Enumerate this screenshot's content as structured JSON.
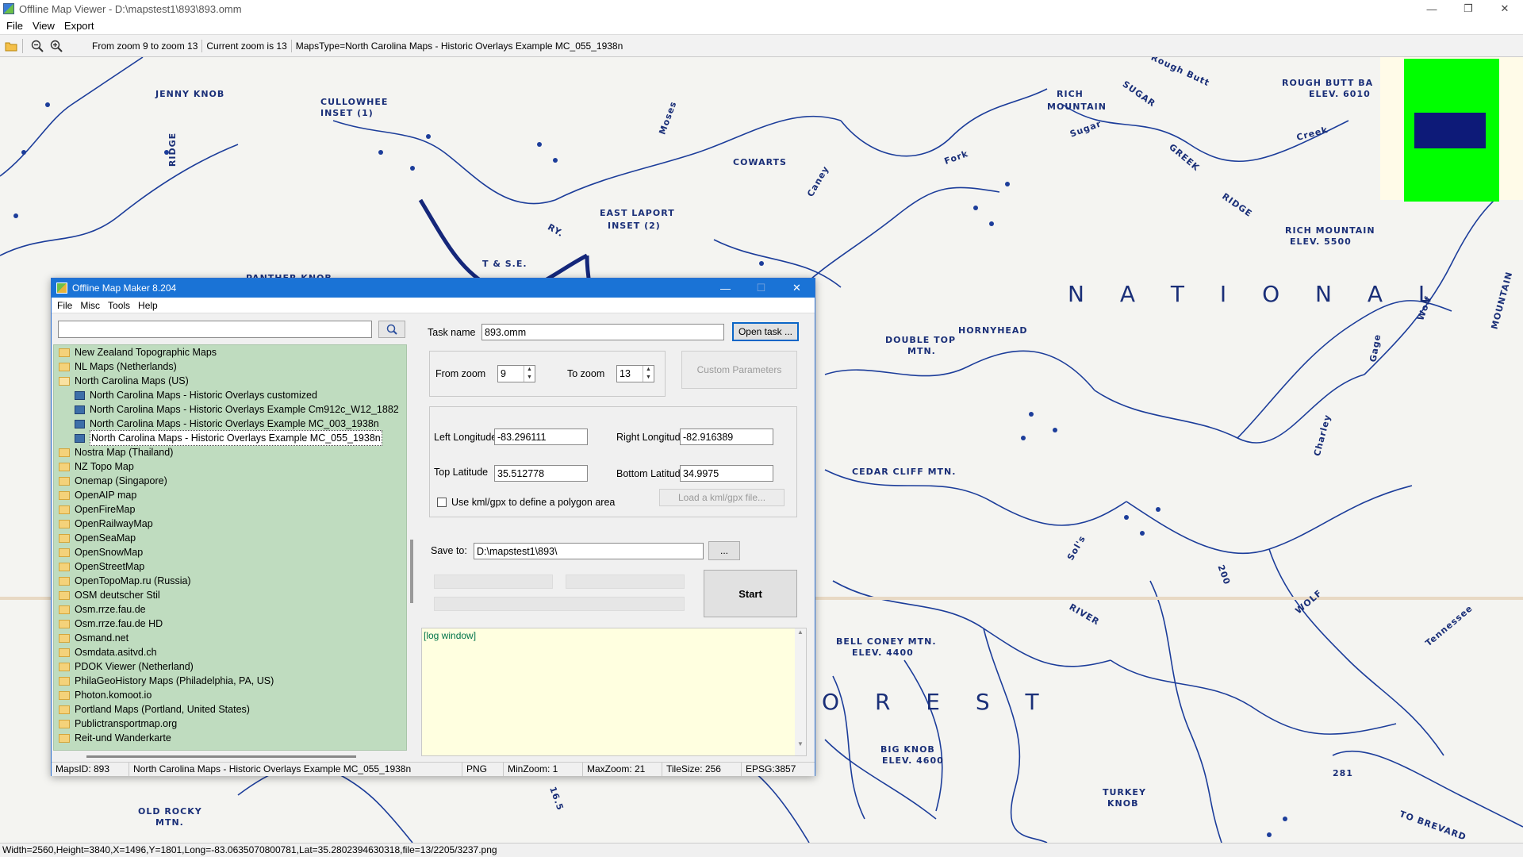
{
  "viewer": {
    "title": "Offline Map Viewer - D:\\mapstest1\\893\\893.omm",
    "window_buttons": [
      "—",
      "❐",
      "✕"
    ],
    "menu": [
      "File",
      "View",
      "Export"
    ],
    "toolbar_info": {
      "zoom_range": "From zoom 9 to zoom 13",
      "current_zoom": "Current zoom is 13",
      "maps_type": "MapsType=North Carolina Maps - Historic Overlays Example MC_055_1938n"
    },
    "status": "Width=2560,Height=3840,X=1496,Y=1801,Long=-83.0635070800781,Lat=35.2802394630318,file=13/2205/3237.png",
    "overview_colors": {
      "background": "#fffbe8",
      "fill": "#00ff00",
      "viewport": "#0d1a78"
    }
  },
  "map_labels": [
    "JENNY KNOB",
    "CULLOWHEE",
    "INSET (1)",
    "EAST LAPORT",
    "INSET (2)",
    "COWARTS",
    "Caney",
    "Fork",
    "RICH",
    "MOUNTAIN",
    "SUGAR",
    "Sugar",
    "Rough Butt",
    "ROUGH BUTT BA",
    "ELEV. 6010",
    "Creek",
    "GREEK",
    "RIDGE",
    "RICH MOUNTAIN",
    "ELEV. 5500",
    "N A T I O N A L",
    "HORNYHEAD",
    "DOUBLE TOP",
    "MTN.",
    "CEDAR CLIFF MTN.",
    "BELL CONEY MTN.",
    "ELEV. 4400",
    "O R E S T",
    "BIG KNOB",
    "ELEV. 4600",
    "TURKEY",
    "KNOB",
    "OLD ROCKY",
    "MTN.",
    "TO BREVARD",
    "Tennessee",
    "WOLF",
    "Charley",
    "Moses",
    "Sol's",
    "RIVER",
    "PANTHER KNOB",
    "T & S.E.",
    "RY.",
    "MOUNTAIN",
    "Wolf",
    "Gage",
    "RIDGE",
    "281",
    "200",
    "16.5"
  ],
  "maker": {
    "title": "Offline Map Maker 8.204",
    "window_buttons": [
      "—",
      "☐",
      "✕"
    ],
    "menu": [
      "File",
      "Misc",
      "Tools",
      "Help"
    ],
    "search": {
      "value": "",
      "placeholder": ""
    },
    "tree": [
      {
        "label": "New Zealand Topographic Maps",
        "level": 0
      },
      {
        "label": "NL Maps (Netherlands)",
        "level": 0
      },
      {
        "label": "North Carolina Maps (US)",
        "level": 0,
        "expanded": true
      },
      {
        "label": "North Carolina Maps - Historic Overlays customized",
        "level": 1
      },
      {
        "label": "North Carolina Maps - Historic Overlays Example Cm912c_W12_1882",
        "level": 1
      },
      {
        "label": "North Carolina Maps - Historic Overlays Example MC_003_1938n",
        "level": 1
      },
      {
        "label": "North Carolina Maps - Historic Overlays Example MC_055_1938n",
        "level": 1,
        "selected": true
      },
      {
        "label": "Nostra Map (Thailand)",
        "level": 0
      },
      {
        "label": "NZ Topo Map",
        "level": 0
      },
      {
        "label": "Onemap (Singapore)",
        "level": 0
      },
      {
        "label": "OpenAIP map",
        "level": 0
      },
      {
        "label": "OpenFireMap",
        "level": 0
      },
      {
        "label": "OpenRailwayMap",
        "level": 0
      },
      {
        "label": "OpenSeaMap",
        "level": 0
      },
      {
        "label": "OpenSnowMap",
        "level": 0
      },
      {
        "label": "OpenStreetMap",
        "level": 0
      },
      {
        "label": "OpenTopoMap.ru (Russia)",
        "level": 0
      },
      {
        "label": "OSM deutscher Stil",
        "level": 0
      },
      {
        "label": "Osm.rrze.fau.de",
        "level": 0
      },
      {
        "label": "Osm.rrze.fau.de HD",
        "level": 0
      },
      {
        "label": "Osmand.net",
        "level": 0
      },
      {
        "label": "Osmdata.asitvd.ch",
        "level": 0
      },
      {
        "label": "PDOK Viewer (Netherland)",
        "level": 0
      },
      {
        "label": "PhilaGeoHistory Maps (Philadelphia, PA, US)",
        "level": 0
      },
      {
        "label": "Photon.komoot.io",
        "level": 0
      },
      {
        "label": "Portland Maps (Portland, United States)",
        "level": 0
      },
      {
        "label": "Publictransportmap.org",
        "level": 0
      },
      {
        "label": "Reit-und Wanderkarte",
        "level": 0
      }
    ],
    "task": {
      "label": "Task name",
      "value": "893.omm",
      "open_button": "Open task ..."
    },
    "zoom": {
      "from_label": "From zoom",
      "from_value": "9",
      "to_label": "To zoom",
      "to_value": "13",
      "custom_button": "Custom Parameters"
    },
    "bounds": {
      "left_label": "Left Longitude",
      "left_value": "-83.296111",
      "right_label": "Right Longitude",
      "right_value": "-82.916389",
      "top_label": "Top Latitude",
      "top_value": "35.512778",
      "bottom_label": "Bottom Latitude",
      "bottom_value": "34.9975",
      "kml_label": "Use kml/gpx to define a polygon area",
      "kml_button": "Load a kml/gpx file..."
    },
    "save": {
      "label": "Save to:",
      "value": "D:\\mapstest1\\893\\",
      "browse_button": "..."
    },
    "start_button": "Start",
    "log_text": "[log window]",
    "status": {
      "maps_id": "MapsID: 893",
      "maps_name": "North Carolina Maps - Historic Overlays Example MC_055_1938n",
      "format": "PNG",
      "min_zoom": "MinZoom: 1",
      "max_zoom": "MaxZoom: 21",
      "tile_size": "TileSize: 256",
      "epsg": "EPSG:3857"
    }
  }
}
